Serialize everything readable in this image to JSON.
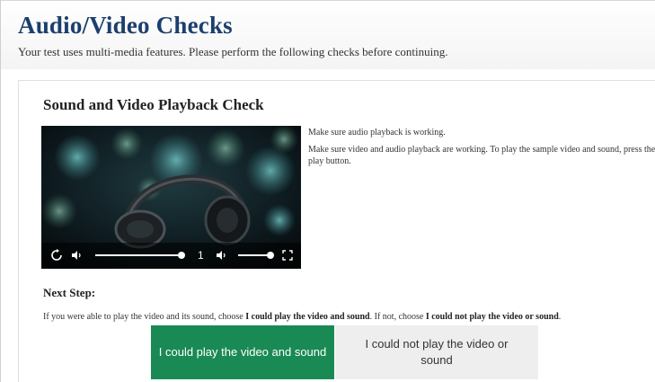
{
  "header": {
    "title": "Audio/Video Checks",
    "subtitle": "Your test uses multi-media features. Please perform the following checks before continuing."
  },
  "check": {
    "title": "Sound and Video Playback Check",
    "instruction_1": "Make sure audio playback is working.",
    "instruction_2": "Make sure video and audio playback are working. To play the sample video and sound, press the play button."
  },
  "player": {
    "speed": "1",
    "icons": [
      "replay-icon",
      "volume-icon",
      "volume-icon",
      "fullscreen-icon"
    ],
    "volume_level_1": 1.0,
    "volume_level_2": 1.0
  },
  "next": {
    "heading": "Next Step:",
    "text_1": "If you were able to play the video and its sound, choose ",
    "bold_1": "I could play the video and sound",
    "text_2": ". If not, choose ",
    "bold_2": "I could not play the video or sound",
    "text_3": "."
  },
  "buttons": {
    "yes": "I could play the video and sound",
    "no": "I could not play the video or sound"
  },
  "colors": {
    "title": "#1b3f6e",
    "yes_button": "#1a8a55",
    "no_button": "#eeeeee"
  }
}
